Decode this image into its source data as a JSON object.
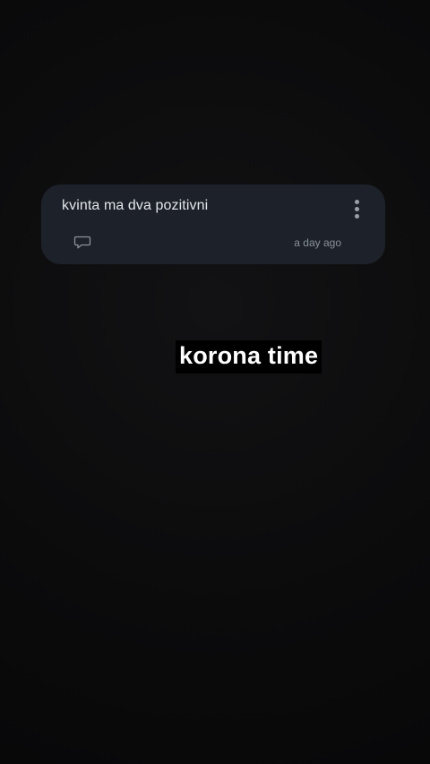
{
  "post": {
    "text": "kvinta ma dva pozitivni",
    "timestamp": "a day ago",
    "more_icon": "more-vertical-icon",
    "comment_icon": "comment-bubble-icon"
  },
  "caption": {
    "text": "korona time"
  },
  "colors": {
    "background": "#0b0b0c",
    "card": "#1d222a",
    "text_primary": "#e3e6ea",
    "text_secondary": "#8a9099",
    "caption_bg": "#000000",
    "caption_text": "#ffffff"
  }
}
